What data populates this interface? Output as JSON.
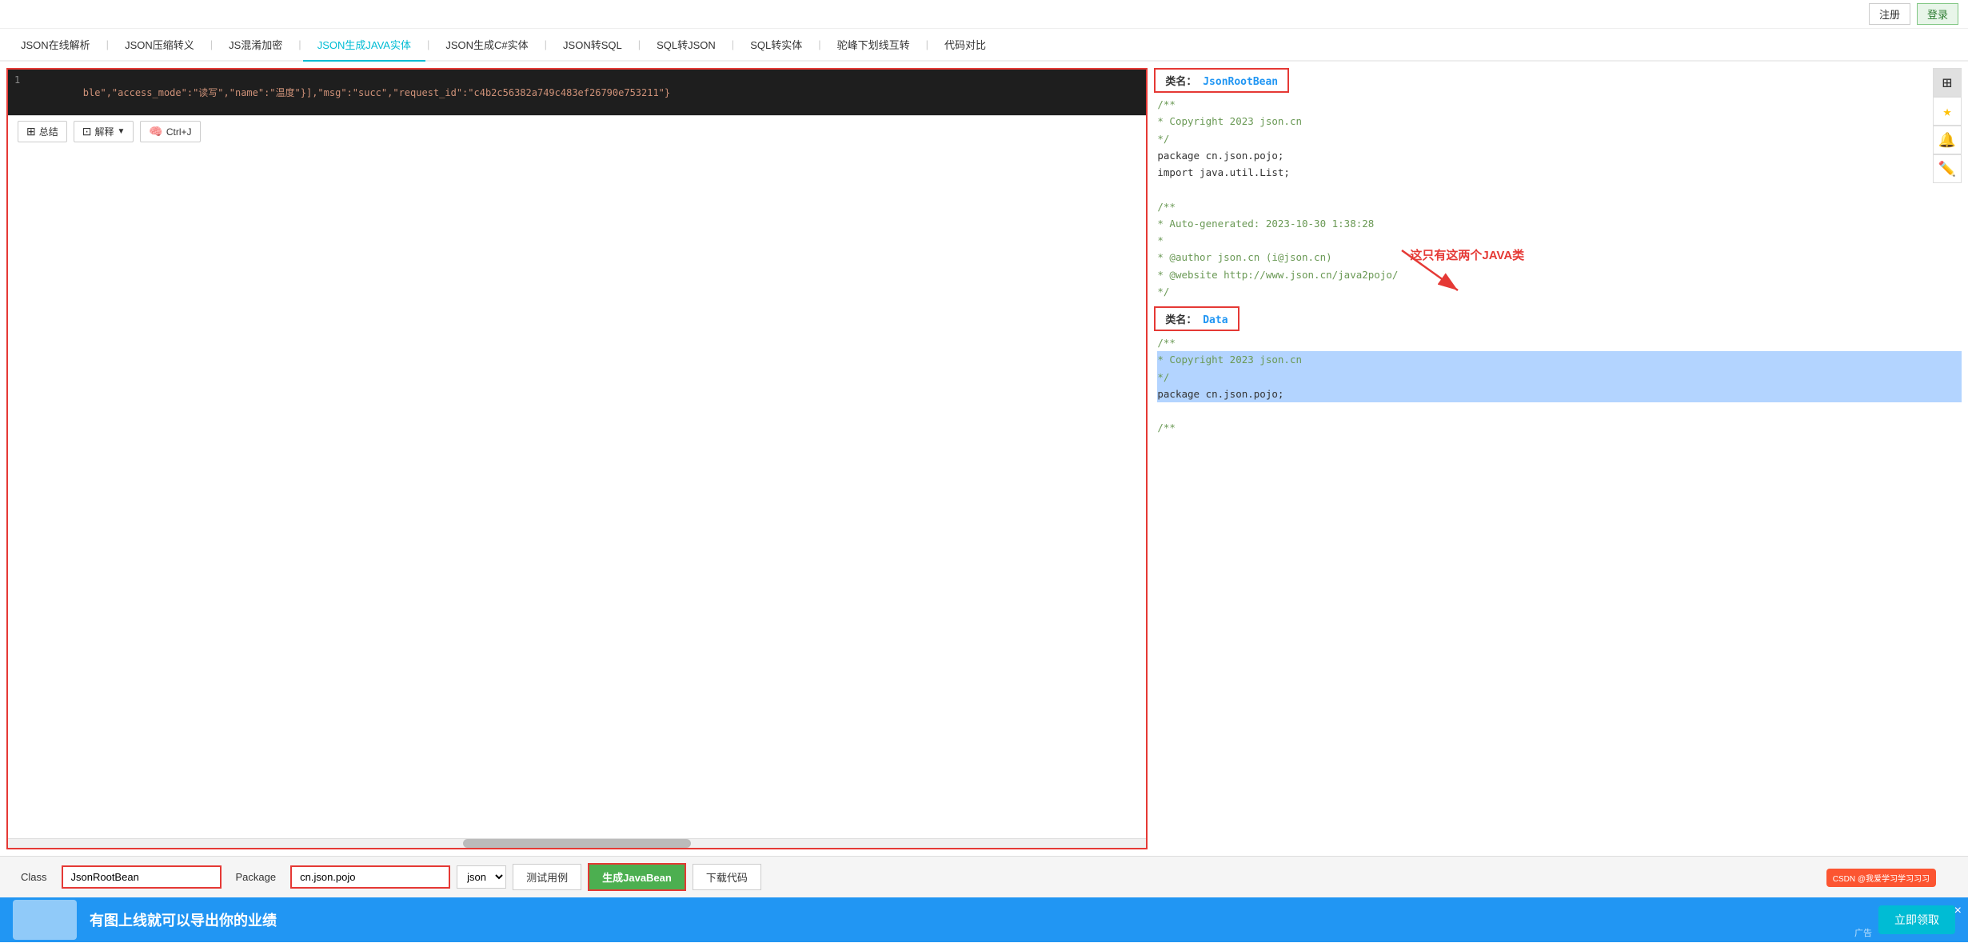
{
  "topbar": {
    "register_label": "注册",
    "login_label": "登录"
  },
  "nav": {
    "tabs": [
      {
        "id": "json-parse",
        "label": "JSON在线解析",
        "active": false
      },
      {
        "id": "json-compress",
        "label": "JSON压缩转义",
        "active": false
      },
      {
        "id": "js-obfuscate",
        "label": "JS混淆加密",
        "active": false
      },
      {
        "id": "json-java",
        "label": "JSON生成JAVA实体",
        "active": true
      },
      {
        "id": "json-csharp",
        "label": "JSON生成C#实体",
        "active": false
      },
      {
        "id": "json-sql",
        "label": "JSON转SQL",
        "active": false
      },
      {
        "id": "sql-json",
        "label": "SQL转JSON",
        "active": false
      },
      {
        "id": "sql-entity",
        "label": "SQL转实体",
        "active": false
      },
      {
        "id": "camel-underline",
        "label": "驼峰下划线互转",
        "active": false
      },
      {
        "id": "code-compare",
        "label": "代码对比",
        "active": false
      }
    ]
  },
  "editor": {
    "line1": "ble\",\"access_mode\":\"读写\",\"name\":\"温度\"}],\"msg\":\"succ\",\"request_id\":\"c4b2c56382a749c483ef26790e753211\"}"
  },
  "toolbar": {
    "summary_label": "总结",
    "interpret_label": "解释",
    "ctrlj_label": "Ctrl+J"
  },
  "output": {
    "class1": {
      "label": "类名：",
      "name": "JsonRootBean",
      "code_lines": [
        "/**",
        " * Copyright 2023 json.cn",
        " */",
        "package cn.json.pojo;",
        "import java.util.List;",
        "",
        "/**",
        " * Auto-generated: 2023-10-30 1:38:28",
        " *",
        " * @author json.cn (i@json.cn)",
        " * @website http://www.json.cn/java2pojo/",
        " */"
      ]
    },
    "class2": {
      "label": "类名：",
      "name": "Data",
      "code_lines": [
        "/**",
        " * Copyright 2023 json.cn",
        " */",
        "package cn.json.pojo;",
        "",
        "/**"
      ]
    },
    "annotation": {
      "text": "这只有这两个JAVA类"
    }
  },
  "bottom": {
    "class_label": "Class",
    "class_input_value": "JsonRootBean",
    "package_label": "Package",
    "package_input_value": "cn.json.pojo",
    "format_select_value": "json",
    "test_case_label": "测试用例",
    "generate_btn_label": "生成JavaBean",
    "download_btn_label": "下载代码"
  },
  "ad": {
    "label": "广告",
    "close_text": "×",
    "csdn_text": "CSDN @我爱学习学习习习"
  }
}
